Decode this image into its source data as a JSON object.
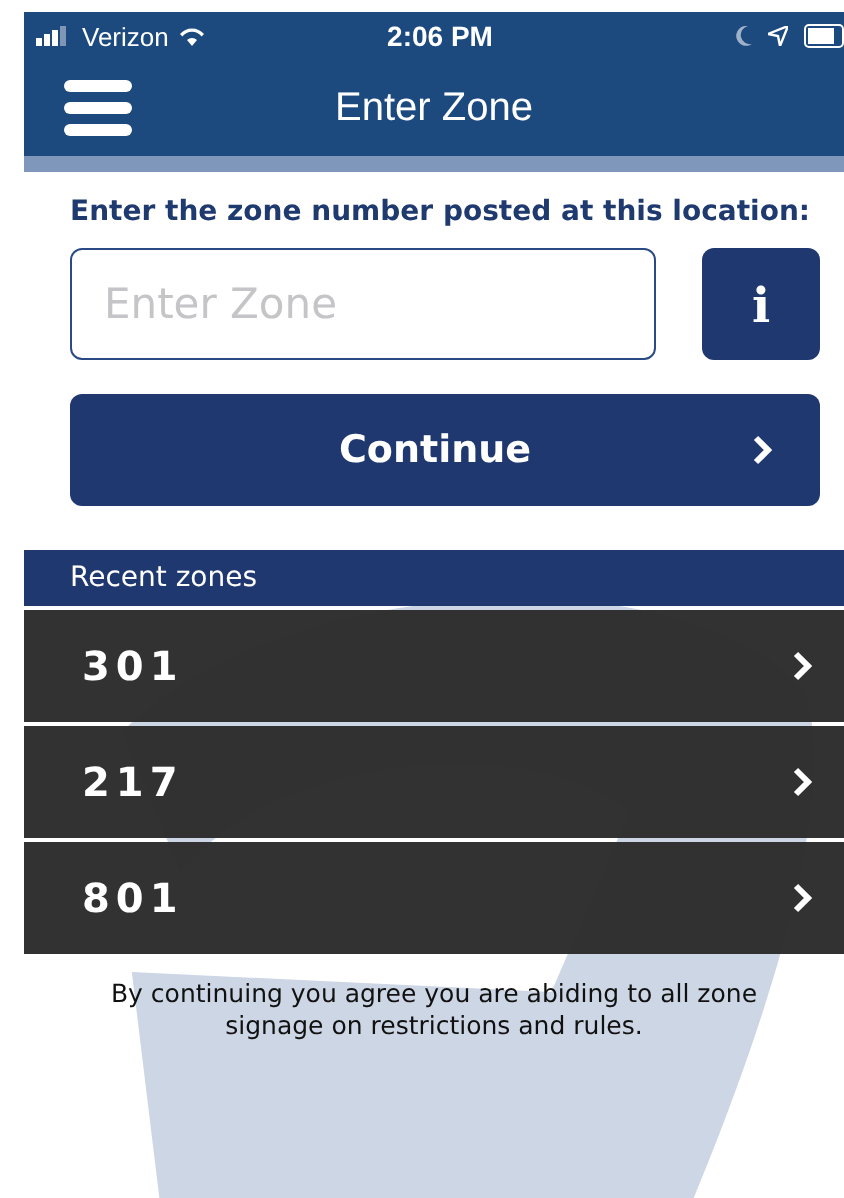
{
  "status_bar": {
    "carrier": "Verizon",
    "time": "2:06 PM"
  },
  "nav_bar": {
    "title": "Enter Zone"
  },
  "prompt": "Enter the zone number posted at this location:",
  "zone_field": {
    "placeholder": "Enter Zone"
  },
  "info_button": {
    "label": "i"
  },
  "continue_button": {
    "label": "Continue"
  },
  "recent_zones": {
    "heading": "Recent zones",
    "items": [
      {
        "zone": "301"
      },
      {
        "zone": "217"
      },
      {
        "zone": "801"
      }
    ]
  },
  "disclaimer": "By continuing you agree you are abiding to all zone signage on restrictions and rules."
}
